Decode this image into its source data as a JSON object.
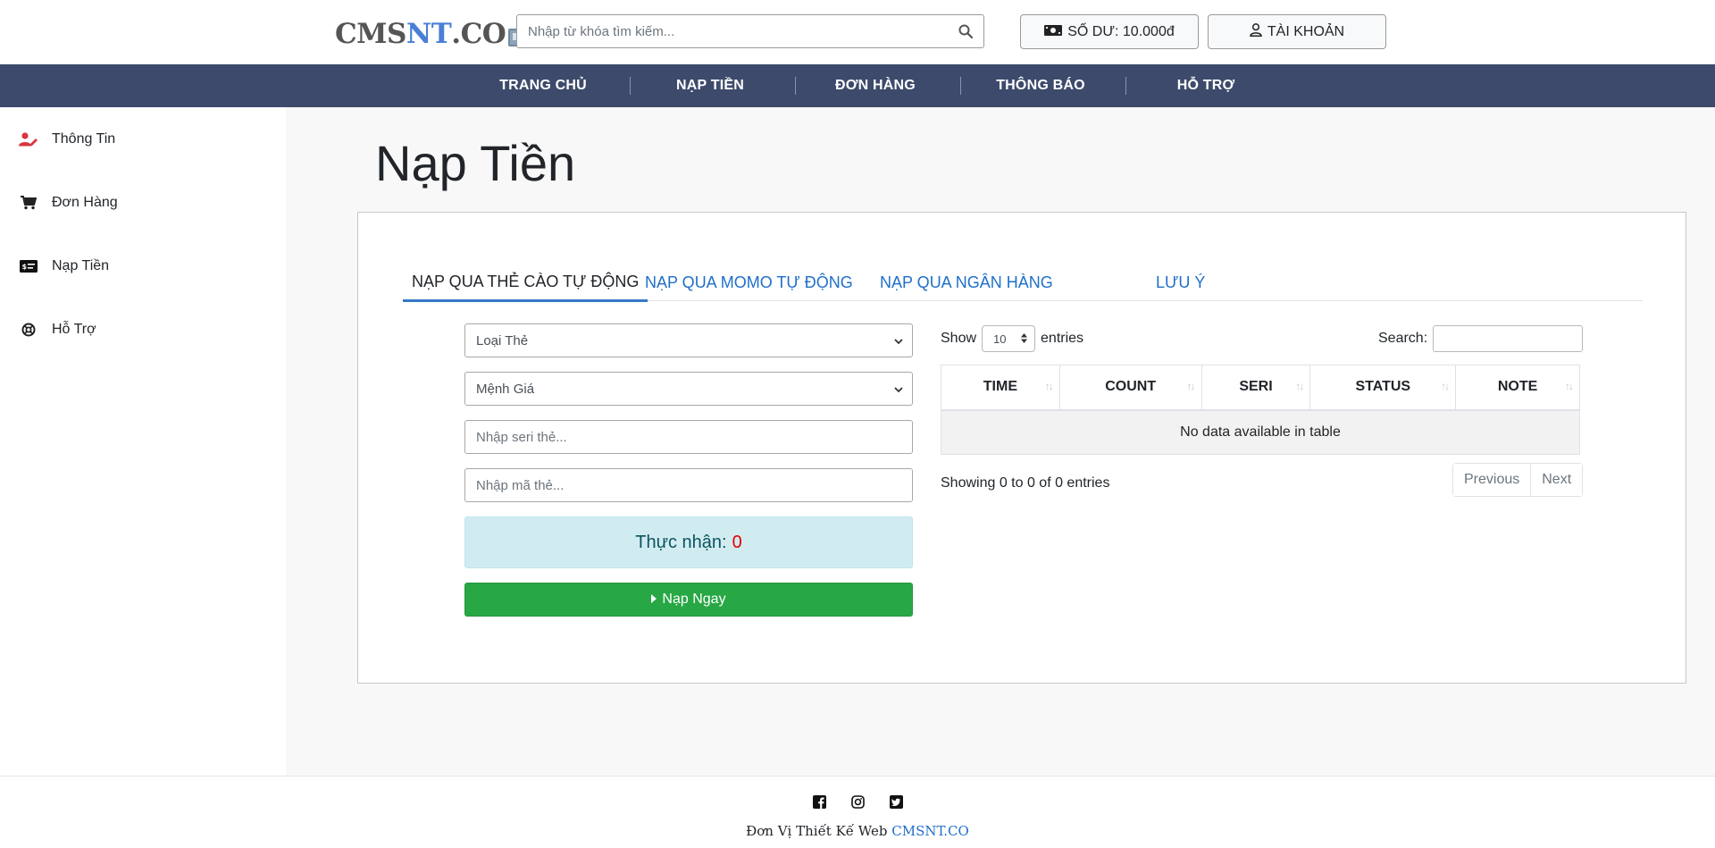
{
  "header": {
    "logo": {
      "part1": "CMS",
      "part2": "NT",
      "part3": ".CO"
    },
    "search_placeholder": "Nhập từ khóa tìm kiếm...",
    "balance_label": "SỐ DƯ: 10.000đ",
    "account_label": "TÀI KHOẢN"
  },
  "nav": {
    "items": [
      {
        "label": "TRANG CHỦ"
      },
      {
        "label": "NẠP TIỀN"
      },
      {
        "label": "ĐƠN HÀNG"
      },
      {
        "label": "THÔNG BÁO"
      },
      {
        "label": "HỖ TRỢ"
      }
    ]
  },
  "sidebar": {
    "items": [
      {
        "label": "Thông Tin",
        "icon": "user-edit-icon"
      },
      {
        "label": "Đơn Hàng",
        "icon": "cart-icon"
      },
      {
        "label": "Nạp Tiền",
        "icon": "money-card-icon"
      },
      {
        "label": "Hỗ Trợ",
        "icon": "lifebuoy-icon"
      }
    ]
  },
  "main": {
    "title": "Nạp Tiền",
    "tabs": [
      {
        "label": "NẠP QUA THẺ CÀO TỰ ĐỘNG",
        "active": true
      },
      {
        "label": "NẠP QUA MOMO TỰ ĐỘNG",
        "active": false
      },
      {
        "label": "NẠP QUA NGÂN HÀNG",
        "active": false
      },
      {
        "label": "LƯU Ý",
        "active": false
      }
    ],
    "form": {
      "card_type_selected": "Loại Thẻ",
      "denomination_selected": "Mệnh Giá",
      "serial_placeholder": "Nhập seri thẻ...",
      "pin_placeholder": "Nhập mã thẻ...",
      "receive_label": "Thực nhận:",
      "receive_value": "0",
      "submit_label": "Nạp Ngay"
    },
    "table": {
      "show_label": "Show",
      "entries_label": "entries",
      "length_value": "10",
      "search_label": "Search:",
      "columns": [
        "TIME",
        "COUNT",
        "SERI",
        "STATUS",
        "NOTE"
      ],
      "empty_message": "No data available in table",
      "info": "Showing 0 to 0 of 0 entries",
      "prev_label": "Previous",
      "next_label": "Next"
    }
  },
  "footer": {
    "credit_text": "Đơn Vị Thiết Kế Web",
    "credit_link": "CMSNT.CO",
    "social": [
      "facebook-icon",
      "instagram-icon",
      "twitter-icon"
    ]
  },
  "colors": {
    "nav_bg": "#3d4a6b",
    "link_blue": "#1f6fc9",
    "success_green": "#28a745",
    "accent_red": "#e30000"
  }
}
